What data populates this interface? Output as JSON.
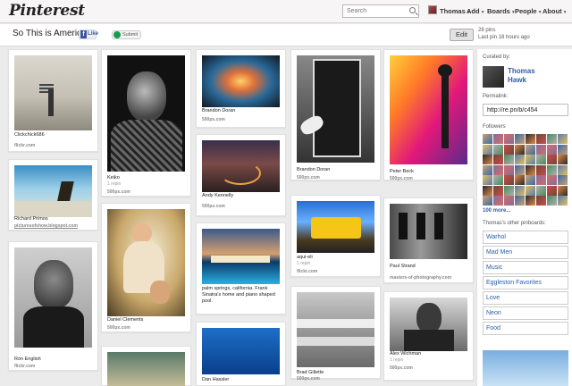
{
  "topbar": {
    "logo": "Pinterest",
    "search_placeholder": "Search",
    "user": "Thomas",
    "nav": [
      "Add",
      "Boards",
      "People",
      "About"
    ]
  },
  "board": {
    "title": "So This is America",
    "like_label": "Like",
    "submit_label": "Submit",
    "edit_label": "Edit",
    "pins_count": "28 pins",
    "last_pin": "Last pin 18 hours ago"
  },
  "pins": [
    {
      "caption": "Clickchick686",
      "sub": "",
      "source": "flickr.com"
    },
    {
      "caption": "Richard Primos",
      "sub": "",
      "source": "picturesofshow.blogspot.com"
    },
    {
      "caption": "Ron English",
      "sub": "",
      "source": "flickr.com"
    },
    {
      "caption": "Keiko",
      "sub": "1 repin",
      "source": "500px.com"
    },
    {
      "caption": "Daniel Clements",
      "sub": "",
      "source": "500px.com"
    },
    {
      "caption": "Brandon Doran",
      "sub": "",
      "source": "500px.com"
    },
    {
      "caption": "Andy Kennelly",
      "sub": "",
      "source": "500px.com"
    },
    {
      "caption": "palm springs, california. Frank Sinatra's home and piano shaped pool.",
      "sub": "",
      "source": ""
    },
    {
      "caption": "Dan Hassler",
      "sub": "",
      "source": ""
    },
    {
      "caption": "Brandon Doran",
      "sub": "",
      "source": "500px.com"
    },
    {
      "caption": "aqui-eli",
      "sub": "1 repin",
      "source": "flickr.com"
    },
    {
      "caption": "Brad Gillette",
      "sub": "",
      "source": "500px.com"
    },
    {
      "caption": "Peter Beck",
      "sub": "",
      "source": "500px.com"
    },
    {
      "caption": "Paul Strand",
      "sub": "",
      "source": "masters-of-photography.com"
    },
    {
      "caption": "Alex Wichman",
      "sub": "1 repin",
      "source": "500px.com"
    }
  ],
  "sidebar": {
    "curated_by": "Curated by:",
    "curator_line1": "Thomas",
    "curator_line2": "Hawk",
    "permalink_label": "Permalink:",
    "permalink": "http://re.pn/b/c454",
    "followers_label": "Followers",
    "more": "100 more...",
    "other_boards_label": "Thomas's other pinboards:",
    "boards": [
      "Warhol",
      "Mad Men",
      "Music",
      "Eggleston Favorites",
      "Love",
      "Neon",
      "Food"
    ]
  }
}
